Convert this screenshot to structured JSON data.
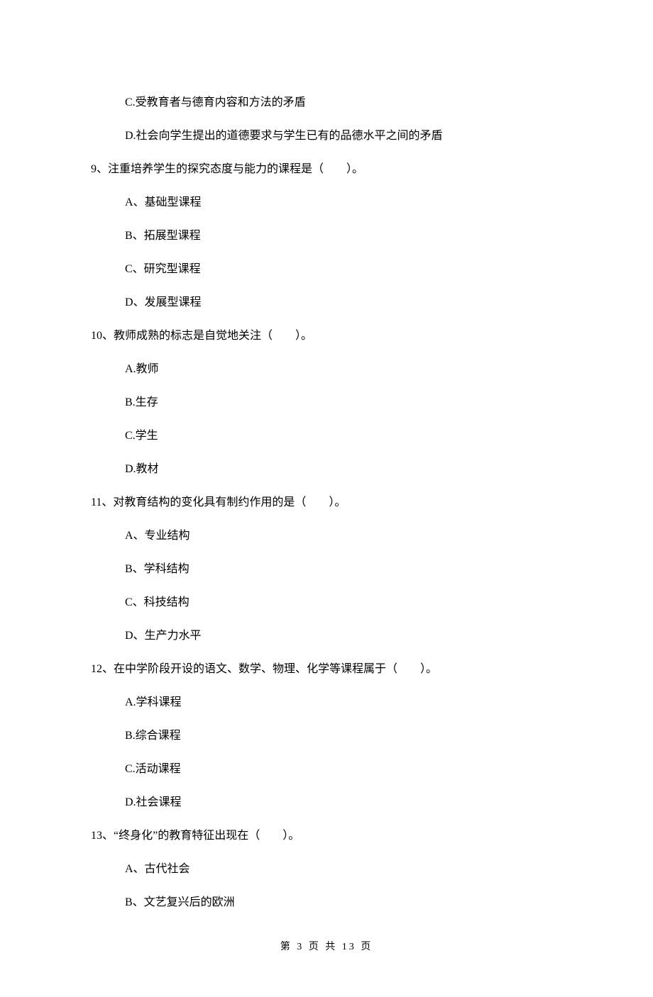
{
  "prev_q_options": {
    "C": "C.受教育者与德育内容和方法的矛盾",
    "D": "D.社会向学生提出的道德要求与学生已有的品德水平之间的矛盾"
  },
  "q9": {
    "stem": "9、注重培养学生的探究态度与能力的课程是（　　）。",
    "A": "A、基础型课程",
    "B": "B、拓展型课程",
    "C": "C、研究型课程",
    "D": "D、发展型课程"
  },
  "q10": {
    "stem": "10、教师成熟的标志是自觉地关注（　　）。",
    "A": "A.教师",
    "B": "B.生存",
    "C": "C.学生",
    "D": "D.教材"
  },
  "q11": {
    "stem": "11、对教育结构的变化具有制约作用的是（　　）。",
    "A": "A、专业结构",
    "B": "B、学科结构",
    "C": "C、科技结构",
    "D": "D、生产力水平"
  },
  "q12": {
    "stem": "12、在中学阶段开设的语文、数学、物理、化学等课程属于（　　）。",
    "A": "A.学科课程",
    "B": "B.综合课程",
    "C": "C.活动课程",
    "D": "D.社会课程"
  },
  "q13": {
    "stem": "13、“终身化”的教育特征出现在（　　）。",
    "A": "A、古代社会",
    "B": "B、文艺复兴后的欧洲"
  },
  "footer": "第 3 页 共 13 页"
}
